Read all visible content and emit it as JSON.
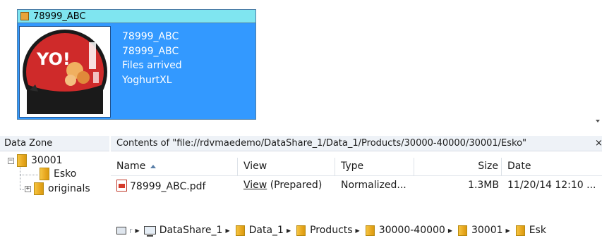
{
  "job_card": {
    "title": "78999_ABC",
    "lines": [
      "78999_ABC",
      "78999_ABC",
      "Files arrived",
      "YoghurtXL"
    ],
    "thumbnail_text": "YO!"
  },
  "tree": {
    "header": "Data Zone",
    "items": [
      {
        "label": "30001",
        "expander": "−"
      },
      {
        "label": "Esko"
      },
      {
        "label": "originals",
        "expander": "+"
      }
    ]
  },
  "contents": {
    "header": "Contents of \"file://rdvmaedemo/DataShare_1/Data_1/Products/30000-40000/30001/Esko\"",
    "close_label": "×",
    "columns": [
      "Name",
      "View",
      "Type",
      "Size",
      "Date"
    ],
    "rows": [
      {
        "name": "78999_ABC.pdf",
        "view_link": "View",
        "view_state": "(Prepared)",
        "type": "Normalized...",
        "size": "1.3MB",
        "date": "11/20/14 12:10 ..."
      }
    ]
  },
  "breadcrumb": {
    "root_faint": "r",
    "items": [
      "DataShare_1",
      "Data_1",
      "Products",
      "30000-40000",
      "30001",
      "Esk"
    ]
  },
  "colors": {
    "card_bg": "#3399ff",
    "card_title_bg": "#7fe5f0",
    "folder": "#e8a820",
    "header_bg": "#eef2f7"
  }
}
